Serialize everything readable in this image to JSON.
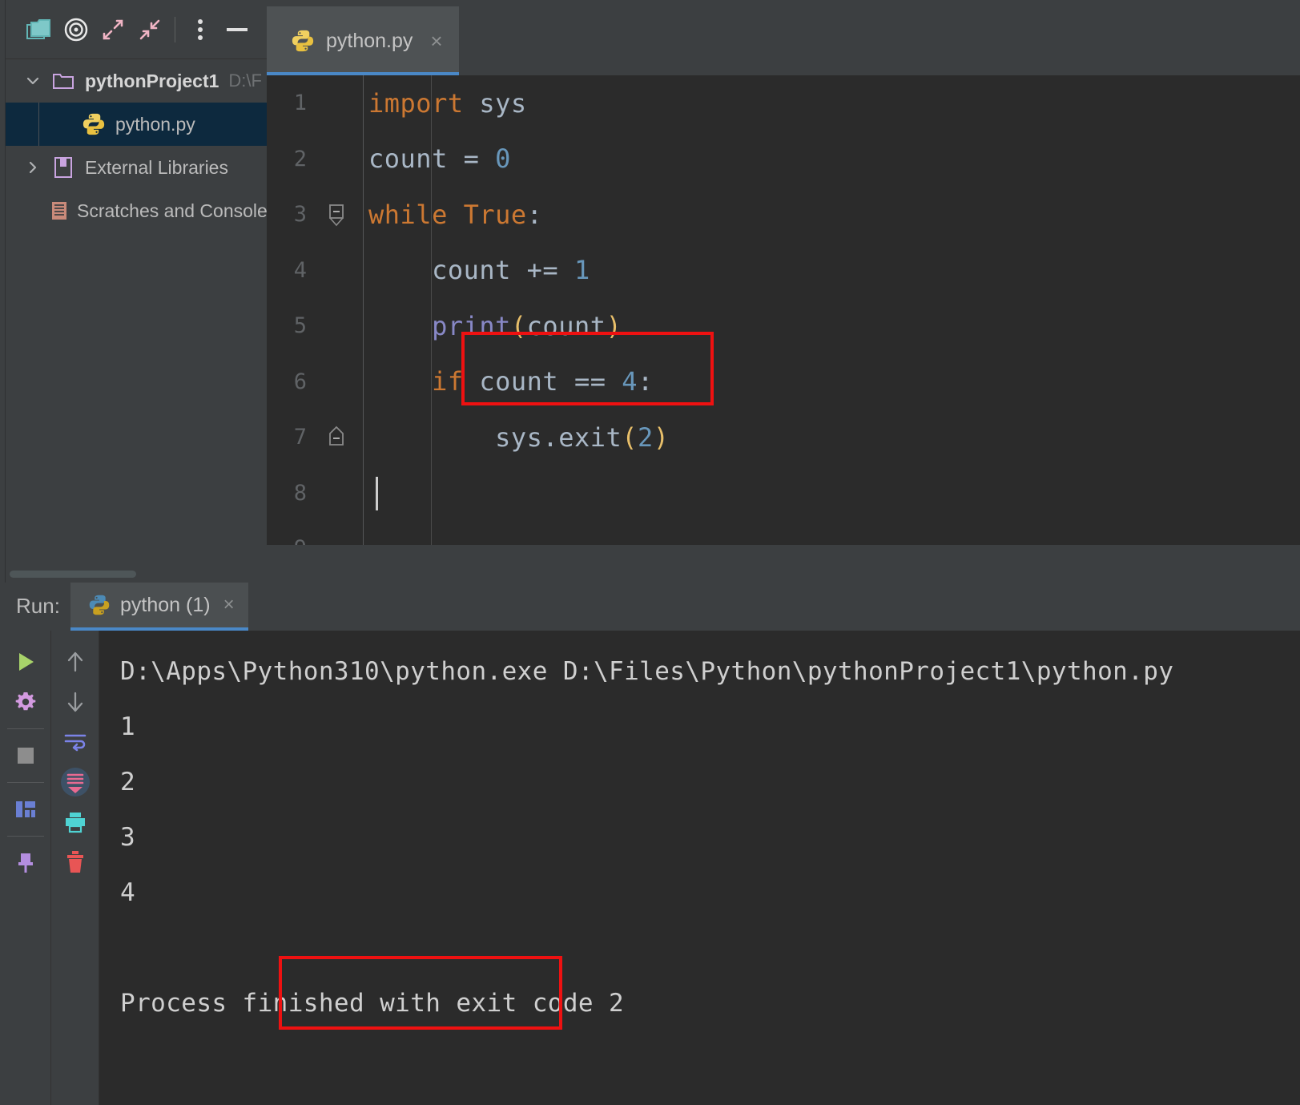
{
  "project_toolbar": {
    "icons": [
      {
        "name": "folder-icon",
        "label": "Select Opened File"
      },
      {
        "name": "target-icon",
        "label": "Scroll from Source"
      },
      {
        "name": "expand-all-icon",
        "label": "Expand All"
      },
      {
        "name": "collapse-all-icon",
        "label": "Collapse All"
      },
      {
        "name": "more-options-icon",
        "label": "Options"
      },
      {
        "name": "minimize-icon",
        "label": "Hide"
      }
    ]
  },
  "project_tree": {
    "items": [
      {
        "label": "pythonProject1",
        "path": "D:\\F",
        "icon": "folder-icon",
        "expanded": true,
        "selected": false,
        "depth": 0
      },
      {
        "label": "python.py",
        "path": "",
        "icon": "python-file-icon",
        "expanded": false,
        "selected": true,
        "depth": 1
      },
      {
        "label": "External Libraries",
        "path": "",
        "icon": "library-icon",
        "expanded": false,
        "selected": false,
        "depth": 0
      },
      {
        "label": "Scratches and Console",
        "path": "",
        "icon": "scratches-icon",
        "expanded": false,
        "selected": false,
        "depth": 0
      }
    ]
  },
  "editor": {
    "tab": {
      "label": "python.py",
      "icon": "python-file-icon",
      "close": "×",
      "active": true
    },
    "lines": [
      {
        "no": "1",
        "fold": "none",
        "tokens": [
          {
            "t": "import",
            "c": "kw"
          },
          {
            "t": " sys",
            "c": "plain"
          }
        ]
      },
      {
        "no": "2",
        "fold": "none",
        "tokens": [
          {
            "t": "count = ",
            "c": "plain"
          },
          {
            "t": "0",
            "c": "num"
          }
        ]
      },
      {
        "no": "3",
        "fold": "start",
        "tokens": [
          {
            "t": "while",
            "c": "kw"
          },
          {
            "t": " ",
            "c": "plain"
          },
          {
            "t": "True",
            "c": "kw"
          },
          {
            "t": ":",
            "c": "plain"
          }
        ]
      },
      {
        "no": "4",
        "fold": "none",
        "tokens": [
          {
            "t": "    count += ",
            "c": "plain"
          },
          {
            "t": "1",
            "c": "num"
          }
        ]
      },
      {
        "no": "5",
        "fold": "none",
        "tokens": [
          {
            "t": "    ",
            "c": "plain"
          },
          {
            "t": "print",
            "c": "fn"
          },
          {
            "t": "(",
            "c": "paren"
          },
          {
            "t": "count",
            "c": "plain"
          },
          {
            "t": ")",
            "c": "paren"
          }
        ]
      },
      {
        "no": "6",
        "fold": "none",
        "tokens": [
          {
            "t": "    ",
            "c": "plain"
          },
          {
            "t": "if",
            "c": "kw"
          },
          {
            "t": " count == ",
            "c": "plain"
          },
          {
            "t": "4",
            "c": "num"
          },
          {
            "t": ":",
            "c": "plain"
          }
        ]
      },
      {
        "no": "7",
        "fold": "end",
        "tokens": [
          {
            "t": "        sys.exit",
            "c": "plain"
          },
          {
            "t": "(",
            "c": "paren"
          },
          {
            "t": "2",
            "c": "num"
          },
          {
            "t": ")",
            "c": "paren"
          }
        ]
      },
      {
        "no": "8",
        "fold": "none",
        "tokens": [
          {
            "t": "",
            "c": "plain"
          }
        ]
      }
    ],
    "caret_line": "8",
    "highlight_box": {
      "label": "sys.exit(2)",
      "color": "#ee1111"
    }
  },
  "run_panel": {
    "label": "Run:",
    "tab": {
      "label": "python (1)",
      "icon": "python-run-icon",
      "close": "×"
    },
    "toolbar_left": [
      {
        "name": "rerun-button",
        "label": "Rerun",
        "color": "#a8d36a"
      },
      {
        "name": "run-settings-button",
        "label": "Modify Run Configuration",
        "color": "#d39ae0"
      },
      {
        "name": "stop-button",
        "label": "Stop",
        "color": "#8d8d8d"
      },
      {
        "name": "layout-button",
        "label": "Layout Settings",
        "color": "#6a7fd3"
      },
      {
        "name": "pin-tab-button",
        "label": "Pin Tab",
        "color": "#b48ee0"
      }
    ],
    "toolbar_right": [
      {
        "name": "up-arrow-button",
        "label": "Previous Occurrence",
        "color": "#8d9091"
      },
      {
        "name": "down-arrow-button",
        "label": "Next Occurrence",
        "color": "#8d9091"
      },
      {
        "name": "soft-wrap-button",
        "label": "Soft-Wrap",
        "color": "#7b83e8"
      },
      {
        "name": "scroll-to-end-button",
        "label": "Scroll to End",
        "color": "#e86a91"
      },
      {
        "name": "print-button",
        "label": "Print",
        "color": "#4fd3d3"
      },
      {
        "name": "clear-all-button",
        "label": "Clear All",
        "color": "#e85555"
      }
    ],
    "console_lines": [
      {
        "text": "D:\\Apps\\Python310\\python.exe D:\\Files\\Python\\pythonProject1\\python.py",
        "blank": false
      },
      {
        "text": "1",
        "blank": false
      },
      {
        "text": "2",
        "blank": false
      },
      {
        "text": "3",
        "blank": false
      },
      {
        "text": "4",
        "blank": false
      },
      {
        "text": "",
        "blank": true
      },
      {
        "text": "Process finished with exit code 2",
        "blank": false
      }
    ],
    "highlight_box": {
      "label": "with exit code 2",
      "color": "#ee1111"
    }
  },
  "colors": {
    "panel_bg": "#3c3f41",
    "editor_bg": "#2b2b2b",
    "selection_bg": "#0d293e",
    "accent_blue": "#4a88c7",
    "annotation_red": "#ee1111",
    "keyword_orange": "#cc7832",
    "number_blue": "#6897bb",
    "function_purple": "#8888c6",
    "paren_yellow": "#e8bf6a",
    "text_gray": "#a9b7c6"
  }
}
